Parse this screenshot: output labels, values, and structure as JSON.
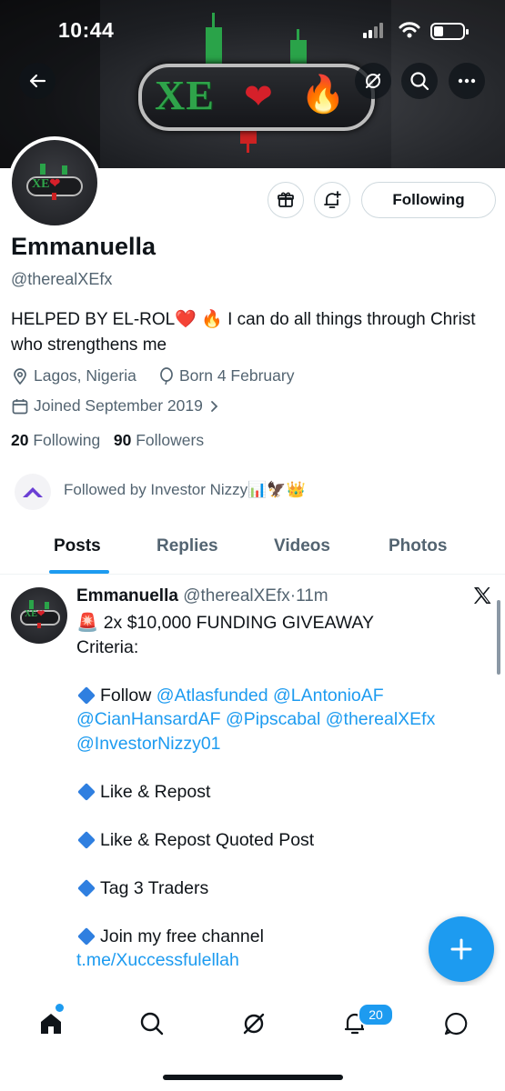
{
  "status_bar": {
    "time": "10:44"
  },
  "banner": {
    "logo_text": "XE",
    "logo_heart": "❤",
    "logo_fire": "🔥"
  },
  "profile": {
    "display_name": "Emmanuella",
    "handle": "@therealXEfx",
    "bio": "HELPED BY EL-ROL❤️ 🔥 I can do all things through Christ who strengthens me",
    "location": "Lagos, Nigeria",
    "birthday": "Born 4 February",
    "joined": "Joined September 2019",
    "following_count": "20",
    "following_label": "Following",
    "followers_count": "90",
    "followers_label": "Followers",
    "follow_button_label": "Following",
    "followed_by": "Followed by Investor Nizzy📊🦅👑"
  },
  "tabs": [
    {
      "label": "Posts",
      "active": true
    },
    {
      "label": "Replies",
      "active": false
    },
    {
      "label": "Videos",
      "active": false
    },
    {
      "label": "Photos",
      "active": false
    }
  ],
  "post": {
    "author_name": "Emmanuella",
    "author_handle": "@therealXEfx",
    "separator": "·",
    "time_ago": "11m",
    "line1": "🚨 2x $10,000 FUNDING GIVEAWAY",
    "line2": "Criteria:",
    "follow_prefix": "Follow",
    "mentions": [
      "@Atlasfunded",
      "@LAntonioAF",
      "@CianHansardAF",
      "@Pipscabal",
      "@therealXEfx",
      "@InvestorNizzy01"
    ],
    "item_like_repost": "Like & Repost",
    "item_like_repost_quoted": "Like & Repost Quoted Post",
    "item_tag": "Tag 3 Traders",
    "item_join": "Join my free channel",
    "channel_link": "t.me/Xuccessfulellah"
  },
  "bottom_nav": {
    "notifications_badge": "20"
  },
  "colors": {
    "accent": "#1d9bf0",
    "muted": "#536471",
    "text": "#0f1419"
  }
}
